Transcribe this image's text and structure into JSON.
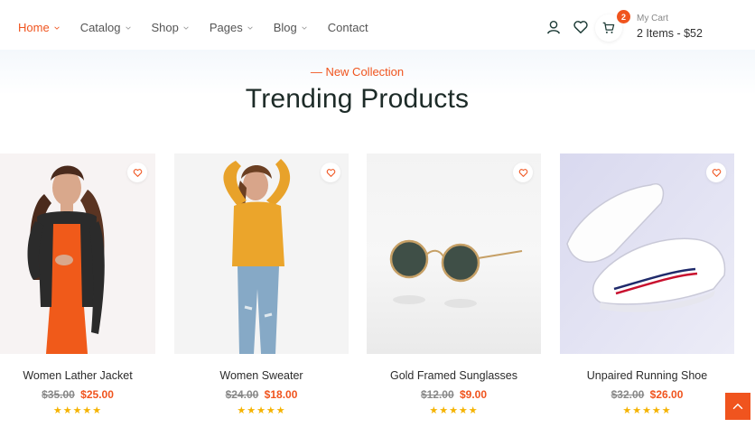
{
  "nav": {
    "items": [
      {
        "label": "Home",
        "active": true,
        "dropdown": true
      },
      {
        "label": "Catalog",
        "active": false,
        "dropdown": true
      },
      {
        "label": "Shop",
        "active": false,
        "dropdown": true
      },
      {
        "label": "Pages",
        "active": false,
        "dropdown": true
      },
      {
        "label": "Blog",
        "active": false,
        "dropdown": true
      },
      {
        "label": "Contact",
        "active": false,
        "dropdown": false
      }
    ]
  },
  "header": {
    "icons": [
      "user-icon",
      "heart-icon",
      "cart-icon"
    ],
    "cart_count": "2",
    "cart_label": "My Cart",
    "cart_summary": "2 Items - $52"
  },
  "section": {
    "eyebrow": "— New Collection",
    "title": "Trending Products"
  },
  "products": [
    {
      "name": "Women Lather Jacket",
      "old_price": "$35.00",
      "price": "$25.00",
      "rating": 5
    },
    {
      "name": "Women Sweater",
      "old_price": "$24.00",
      "price": "$18.00",
      "rating": 5
    },
    {
      "name": "Gold Framed Sunglasses",
      "old_price": "$12.00",
      "price": "$9.00",
      "rating": 5
    },
    {
      "name": "Unpaired Running Shoe",
      "old_price": "$32.00",
      "price": "$26.00",
      "rating": 5
    }
  ],
  "stars_text": "★★★★★",
  "colors": {
    "accent": "#f0541e",
    "text_dark": "#1d2b28",
    "star": "#f5b301"
  }
}
